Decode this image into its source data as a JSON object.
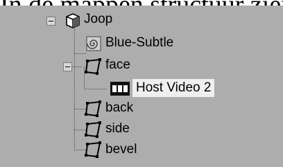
{
  "caption": "In de mappen structuur zien",
  "tree": {
    "root": {
      "label": "Joop",
      "icon": "cube-icon"
    },
    "items": [
      {
        "label": "Blue-Subtle",
        "icon": "swirl-shader-icon"
      },
      {
        "label": "face",
        "icon": "polygon-face-icon"
      },
      {
        "label": "Host Video 2",
        "icon": "film-strip-icon",
        "selected": true
      },
      {
        "label": "back",
        "icon": "polygon-face-icon"
      },
      {
        "label": "side",
        "icon": "polygon-face-icon"
      },
      {
        "label": "bevel",
        "icon": "polygon-face-icon"
      }
    ]
  }
}
